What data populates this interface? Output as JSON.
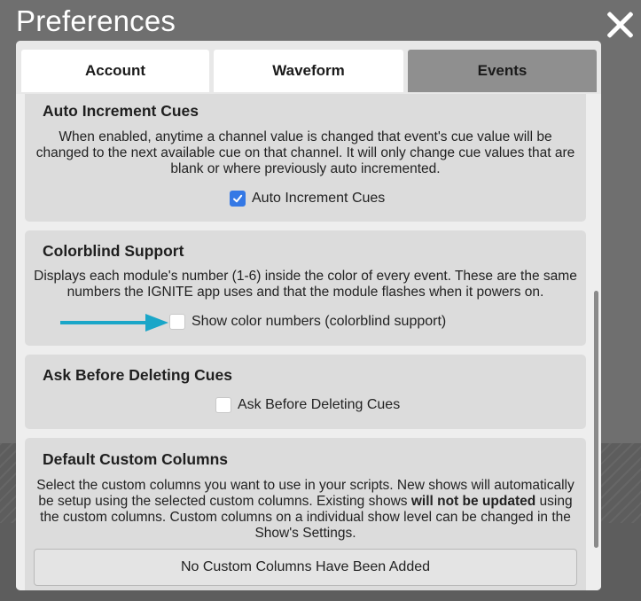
{
  "window": {
    "title": "Preferences"
  },
  "tabs": [
    {
      "label": "Account",
      "active": false
    },
    {
      "label": "Waveform",
      "active": false
    },
    {
      "label": "Events",
      "active": true
    }
  ],
  "sections": {
    "auto_increment": {
      "title": "Auto Increment Cues",
      "desc": "When enabled, anytime a channel value is changed that event's cue value will be changed to the next available cue on that channel. It will only change cue values that are blank or where previously auto incremented.",
      "checkbox_label": "Auto Increment Cues",
      "checked": true
    },
    "colorblind": {
      "title": "Colorblind Support",
      "desc": "Displays each module's number (1-6) inside the color of every event. These are the same numbers the IGNITE app uses and that the module flashes when it powers on.",
      "checkbox_label": "Show color numbers (colorblind support)",
      "checked": false
    },
    "ask_delete": {
      "title": "Ask Before Deleting Cues",
      "checkbox_label": "Ask Before Deleting Cues",
      "checked": false
    },
    "custom_columns": {
      "title": "Default Custom Columns",
      "desc_part1": "Select the custom columns you want to use in your scripts. New shows will automatically be setup using the selected custom columns. Existing shows ",
      "desc_bold": "will not be updated",
      "desc_part2": " using the custom columns. Custom columns on a individual show level can be changed in the Show's Settings.",
      "empty_label": "No Custom Columns Have Been Added"
    }
  },
  "colors": {
    "checkbox_checked": "#3478e5",
    "annotation_arrow": "#1aa6c8",
    "active_tab": "#8f8f8f"
  },
  "icons": {
    "close": "close-icon",
    "check": "check-icon",
    "arrow": "arrow-right-icon"
  }
}
